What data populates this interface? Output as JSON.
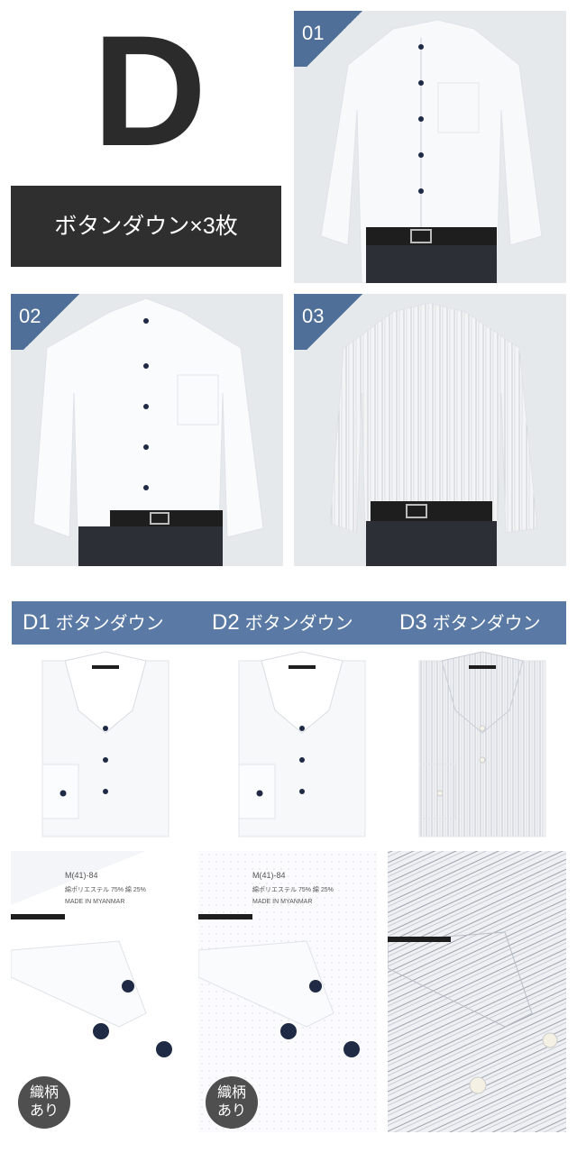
{
  "header": {
    "letter": "D",
    "subtitle": "ボタンダウン×3枚"
  },
  "photos": [
    {
      "number": "01"
    },
    {
      "number": "02"
    },
    {
      "number": "03"
    }
  ],
  "labels": [
    {
      "code": "D1",
      "text": "ボタンダウン"
    },
    {
      "code": "D2",
      "text": "ボタンダウン"
    },
    {
      "code": "D3",
      "text": "ボタンダウン"
    }
  ],
  "details": [
    {
      "tag_line1": "M(41)-84",
      "tag_line2": "綿ポリエステル 75% 綿 25%",
      "tag_line3": "MADE IN MYANMAR",
      "badge_line1": "織柄",
      "badge_line2": "あり"
    },
    {
      "tag_line1": "M(41)-84",
      "tag_line2": "綿ポリエステル 75% 綿 25%",
      "tag_line3": "MADE IN MYANMAR",
      "badge_line1": "織柄",
      "badge_line2": "あり"
    },
    {
      "tag_line1": "",
      "tag_line2": "",
      "tag_line3": ""
    }
  ],
  "colors": {
    "dark_box": "#2f2f2f",
    "accent_blue": "#5a7aa5",
    "corner_blue": "#4f6f98",
    "navy_button": "#1f2a44"
  }
}
